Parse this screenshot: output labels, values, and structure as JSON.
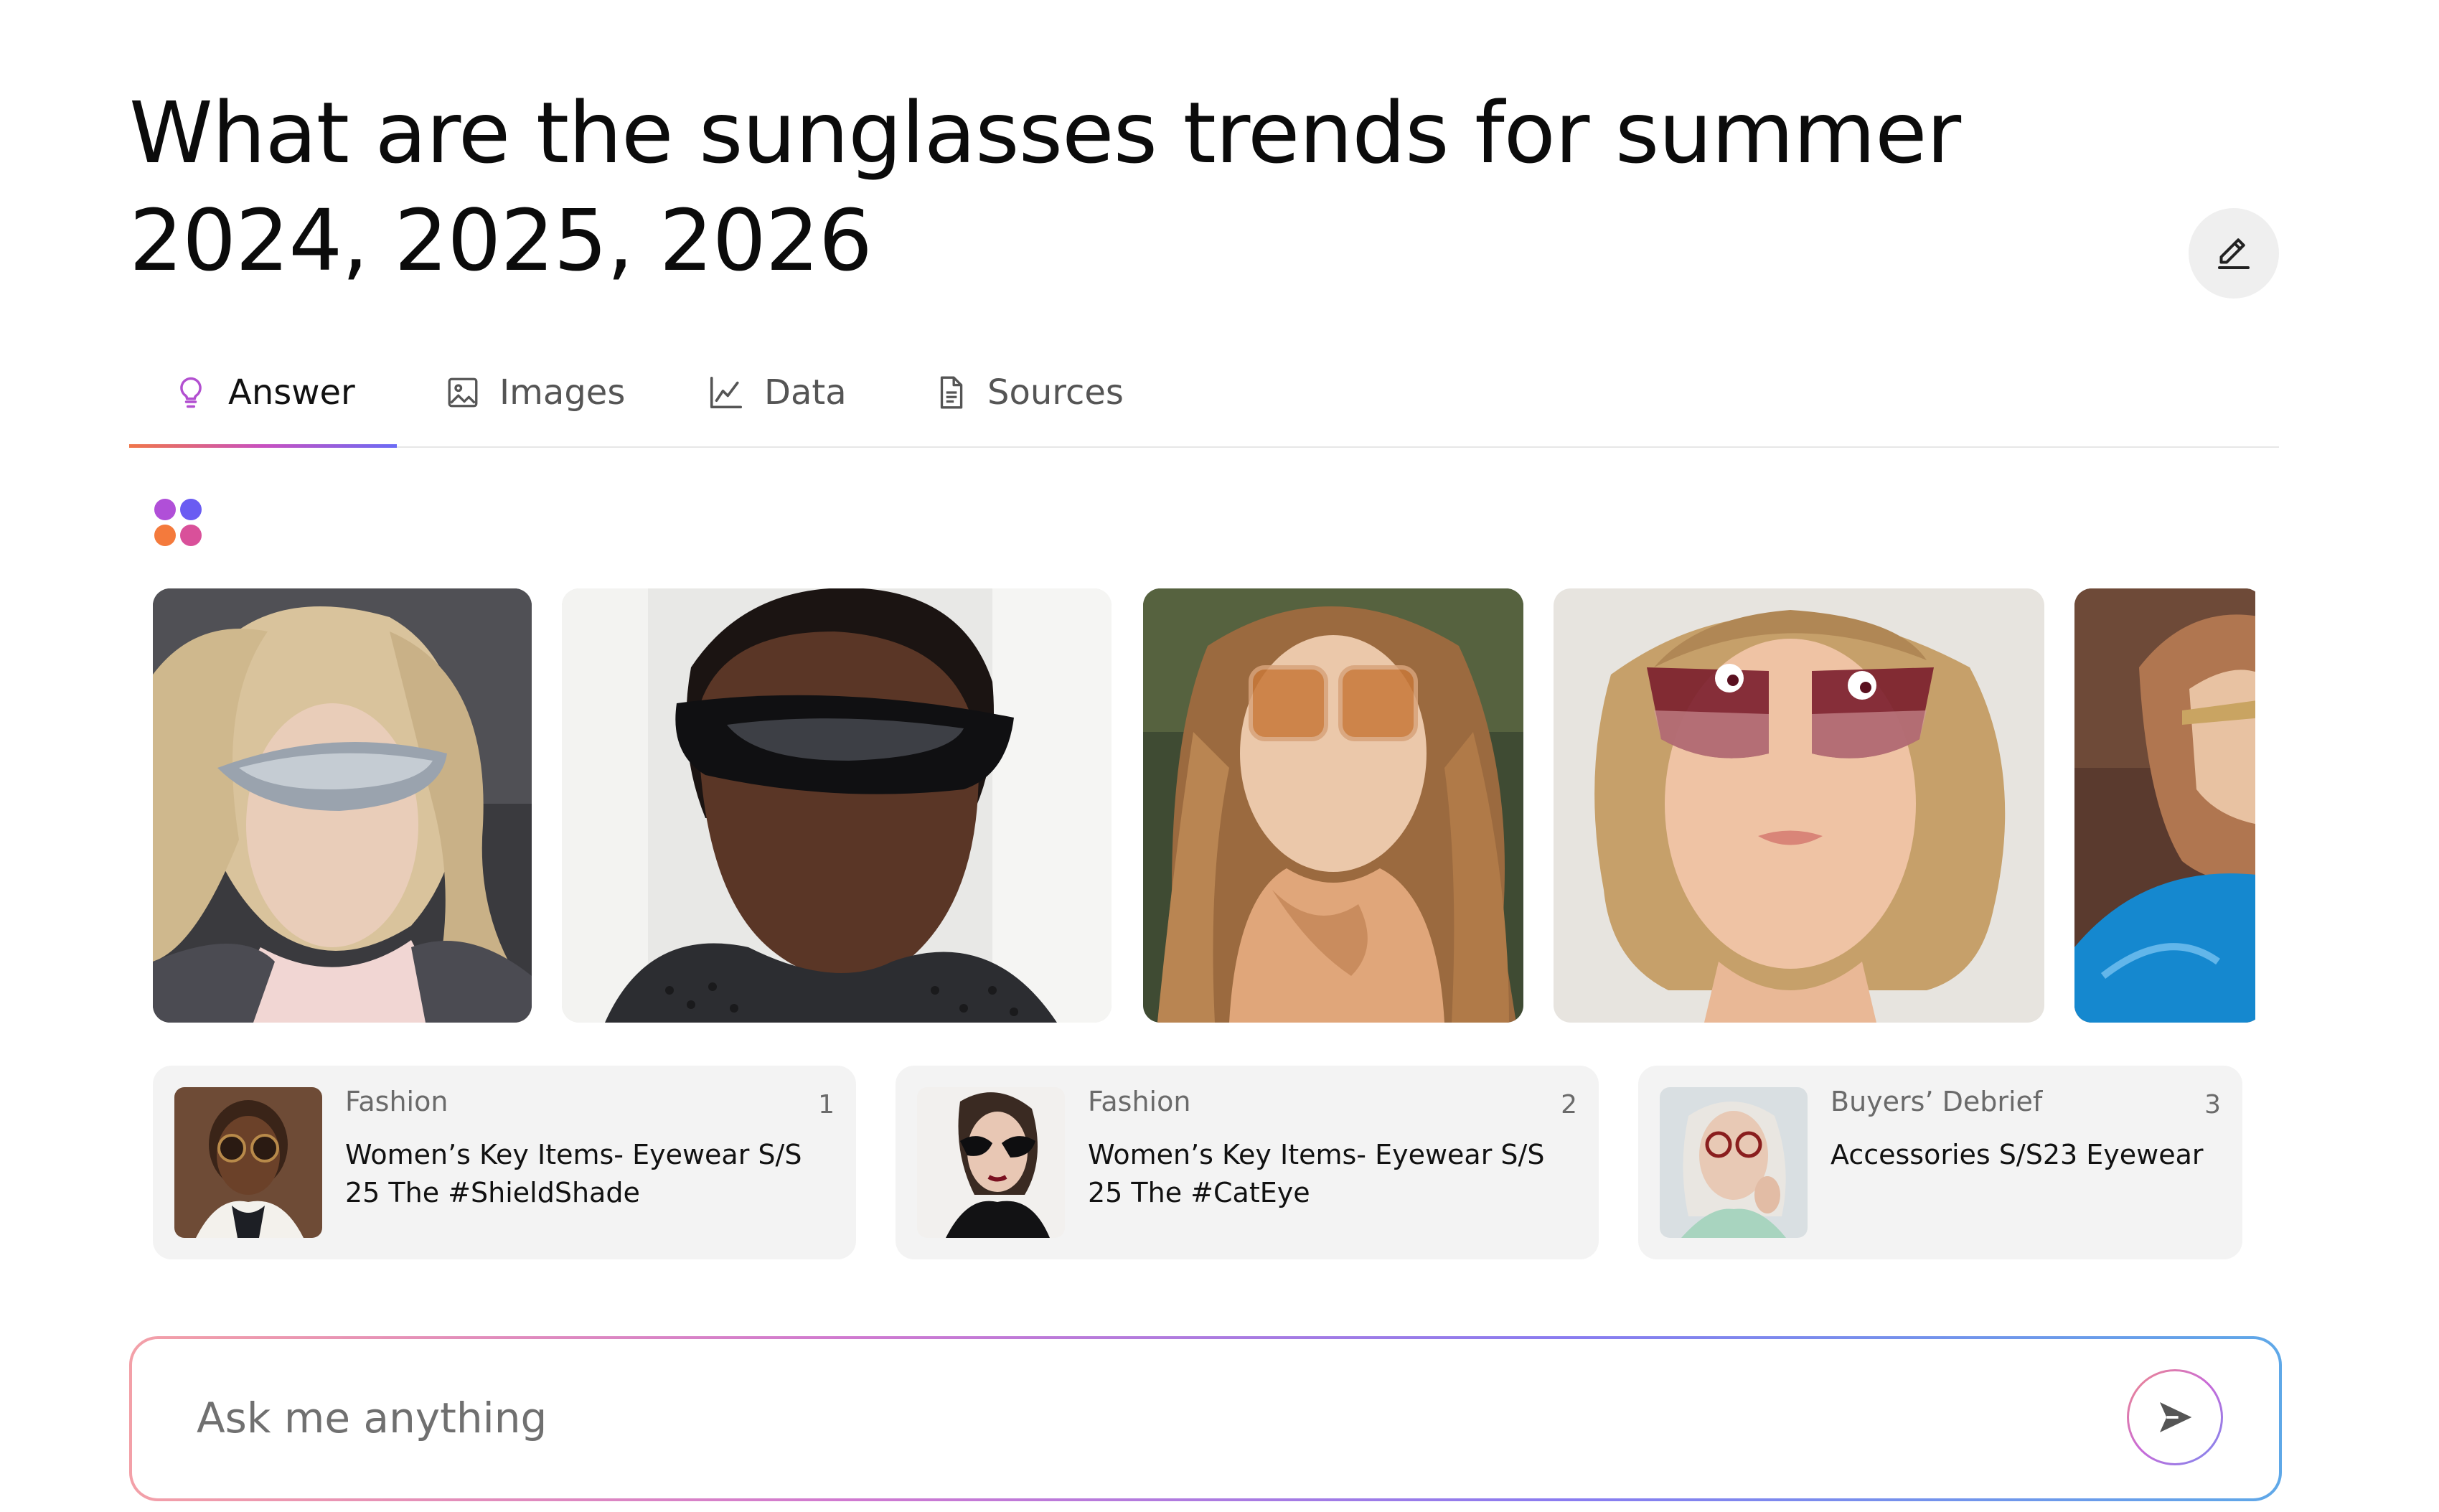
{
  "title": "What are the sunglasses trends for summer 2024, 2025, 2026",
  "tabs": [
    {
      "label": "Answer",
      "icon": "lightbulb-icon",
      "active": true
    },
    {
      "label": "Images",
      "icon": "image-icon",
      "active": false
    },
    {
      "label": "Data",
      "icon": "line-chart-icon",
      "active": false
    },
    {
      "label": "Sources",
      "icon": "document-icon",
      "active": false
    }
  ],
  "colors": {
    "accent_gradient": [
      "#f0764a",
      "#c850c0",
      "#6b6bf5"
    ],
    "card_bg": "#f3f3f3",
    "edit_button_bg": "#efefef"
  },
  "gallery": [
    {
      "name": "runway-shield-sunglasses-blonde"
    },
    {
      "name": "wraparound-black-visor-sunglasses"
    },
    {
      "name": "oversized-amber-square-sunglasses"
    },
    {
      "name": "rimless-burgundy-gradient-sunglasses"
    },
    {
      "name": "gold-frame-sunglasses-partial"
    }
  ],
  "sources": [
    {
      "category": "Fashion",
      "number": "1",
      "title": "Women’s Key Items- Eyewear S/S 25 The #ShieldShade"
    },
    {
      "category": "Fashion",
      "number": "2",
      "title": "Women’s Key Items- Eyewear S/S 25 The #CatEye"
    },
    {
      "category": "Buyers’ Debrief",
      "number": "3",
      "title": "Accessories S/S23 Eyewear"
    }
  ],
  "ask": {
    "placeholder": "Ask me anything",
    "value": ""
  }
}
